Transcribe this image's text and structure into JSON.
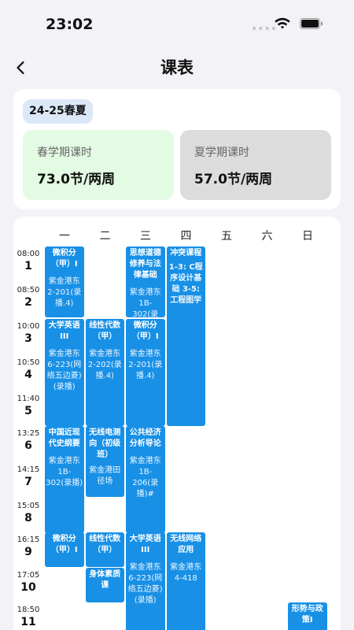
{
  "status": {
    "time": "23:02"
  },
  "nav": {
    "title": "课表"
  },
  "summary": {
    "term": "24-25春夏",
    "spring": {
      "label": "春学期课时",
      "value": "73.0节/两周"
    },
    "summer": {
      "label": "夏学期课时",
      "value": "57.0节/两周"
    }
  },
  "days": [
    "一",
    "二",
    "三",
    "四",
    "五",
    "六",
    "日"
  ],
  "periods": [
    {
      "time": "08:00",
      "num": "1"
    },
    {
      "time": "08:50",
      "num": "2"
    },
    {
      "time": "10:00",
      "num": "3"
    },
    {
      "time": "10:50",
      "num": "4"
    },
    {
      "time": "11:40",
      "num": "5"
    },
    {
      "time": "13:25",
      "num": "6"
    },
    {
      "time": "14:15",
      "num": "7"
    },
    {
      "time": "15:05",
      "num": "8"
    },
    {
      "time": "16:15",
      "num": "9"
    },
    {
      "time": "17:05",
      "num": "10"
    },
    {
      "time": "18:50",
      "num": "11"
    }
  ],
  "courses": [
    {
      "day": 0,
      "start": 0,
      "len": 2,
      "name": "微积分（甲）Ⅰ",
      "room": "紫金港东2-201(录播.4)"
    },
    {
      "day": 2,
      "start": 0,
      "len": 2,
      "name": "思想道德修养与法律基础",
      "room": "紫金港东1B-302(录"
    },
    {
      "day": 3,
      "start": 0,
      "len": 5,
      "name": "冲突课程",
      "room": "1-3: C程序设计基础 3-5: 工程图学"
    },
    {
      "day": 0,
      "start": 2,
      "len": 3,
      "name": "大学英语III",
      "room": "紫金港东6-223(网络五边菱)(录播)"
    },
    {
      "day": 1,
      "start": 2,
      "len": 3,
      "name": "线性代数（甲）",
      "room": "紫金港东2-202(录播.4)"
    },
    {
      "day": 2,
      "start": 2,
      "len": 3,
      "name": "微积分（甲）Ⅰ",
      "room": "紫金港东2-201(录播.4)"
    },
    {
      "day": 0,
      "start": 5,
      "len": 3,
      "name": "中国近现代史纲要",
      "room": "紫金港东1B-302(录播)"
    },
    {
      "day": 1,
      "start": 5,
      "len": 2,
      "name": "无线电测向（初级班）",
      "room": "紫金港田径场"
    },
    {
      "day": 2,
      "start": 5,
      "len": 3,
      "name": "公共经济分析导论",
      "room": "紫金港东1B-206(录播)#"
    },
    {
      "day": 0,
      "start": 8,
      "len": 1,
      "name": "微积分（甲）Ⅰ",
      "room": ""
    },
    {
      "day": 1,
      "start": 8,
      "len": 1,
      "name": "线性代数（甲）",
      "room": ""
    },
    {
      "day": 1,
      "start": 9,
      "len": 1,
      "name": "身体素质课",
      "room": ""
    },
    {
      "day": 2,
      "start": 8,
      "len": 3,
      "name": "大学英语III",
      "room": "紫金港东6-223(网络五边菱)(录播)"
    },
    {
      "day": 3,
      "start": 8,
      "len": 3,
      "name": "无线网络应用",
      "room": "紫金港东4-418"
    },
    {
      "day": 6,
      "start": 10,
      "len": 1,
      "name": "形势与政策I",
      "room": ""
    }
  ],
  "colors": {
    "accent": "#1890e6",
    "background": "#f2f2f7"
  }
}
